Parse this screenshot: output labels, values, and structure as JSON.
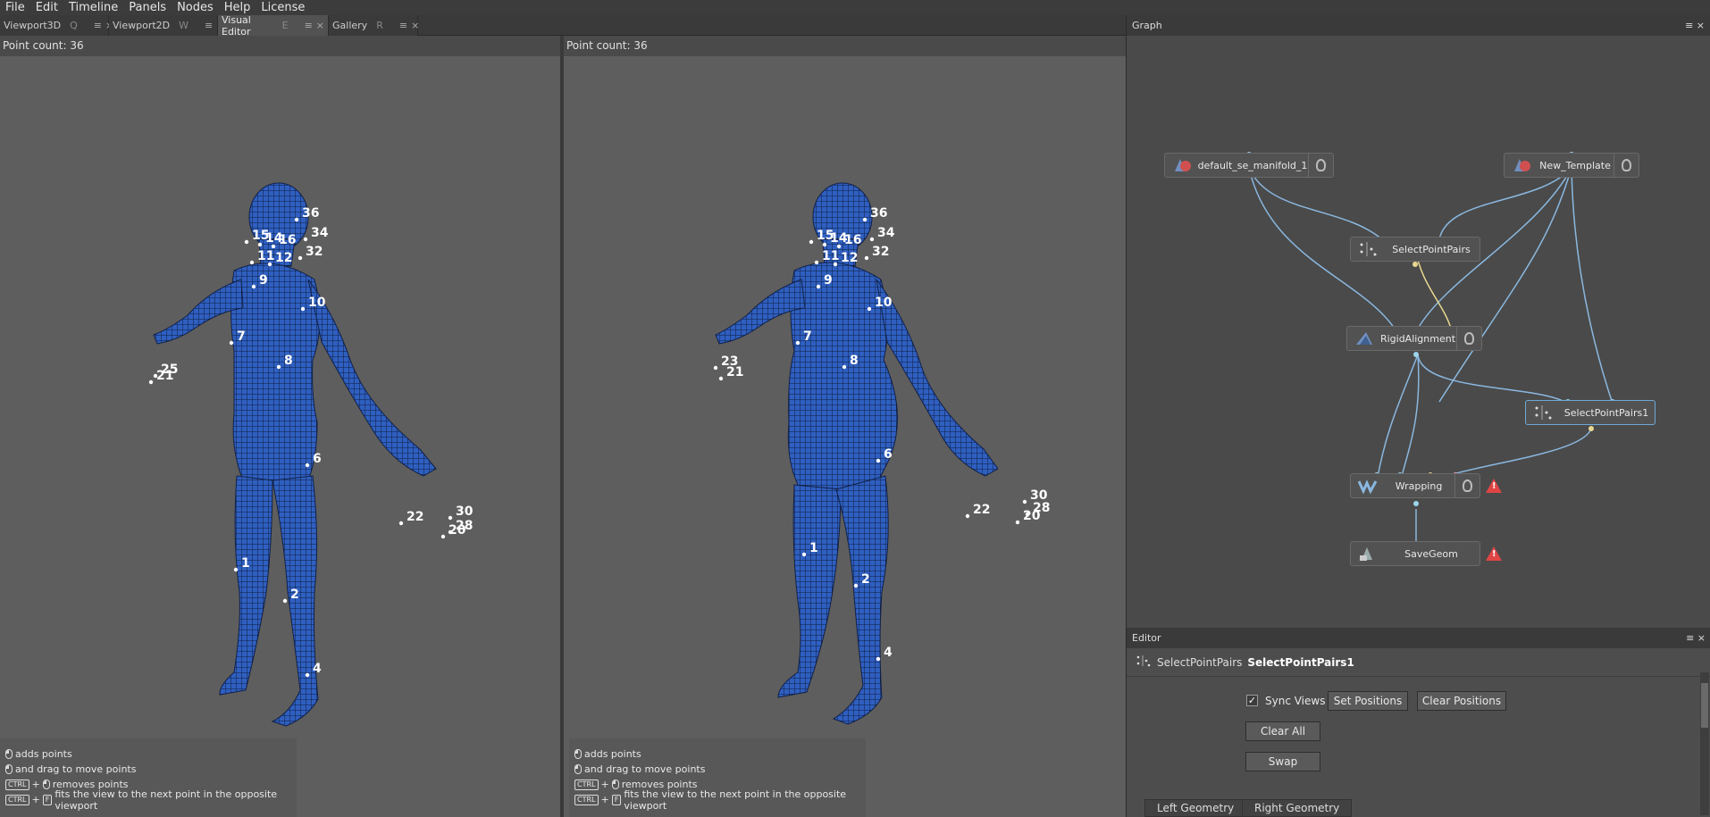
{
  "menu": [
    "File",
    "Edit",
    "Timeline",
    "Panels",
    "Nodes",
    "Help",
    "License"
  ],
  "tabs": [
    {
      "label": "Viewport3D",
      "key": "Q"
    },
    {
      "label": "Viewport2D",
      "key": "W"
    },
    {
      "label": "Visual Editor",
      "key": "E"
    },
    {
      "label": "Gallery",
      "key": "R"
    }
  ],
  "tab_menu_glyph": "≡",
  "tab_close_glyph": "×",
  "left_view": {
    "point_count": "Point count: 36",
    "landmarks": [
      "36",
      "15",
      "14",
      "16",
      "34",
      "32",
      "11",
      "12",
      "9",
      "10",
      "7",
      "25",
      "21",
      "8",
      "6",
      "22",
      "30",
      "28",
      "20",
      "1",
      "2",
      "4"
    ]
  },
  "right_view": {
    "point_count": "Point count: 36",
    "landmarks": [
      "36",
      "15",
      "14",
      "16",
      "34",
      "32",
      "11",
      "12",
      "9",
      "10",
      "7",
      "23",
      "21",
      "8",
      "6",
      "22",
      "30",
      "28",
      "20",
      "1",
      "2",
      "4"
    ]
  },
  "help": [
    {
      "keys": [
        "mouse-icon"
      ],
      "text": "adds points"
    },
    {
      "keys": [
        "mouse-icon"
      ],
      "text": "and drag to move points"
    },
    {
      "keys": [
        "CTRL",
        "+",
        "mouse-icon"
      ],
      "text": "removes points"
    },
    {
      "keys": [
        "CTRL",
        "+",
        "F"
      ],
      "text": "fits the view to the next point in the opposite viewport"
    }
  ],
  "graph": {
    "title": "Graph",
    "nodes": {
      "default_se": "default_se_manifold_1",
      "new_template": "New_Template",
      "select_point_pairs": "SelectPointPairs",
      "rigid_alignment": "RigidAlignment",
      "select_point_pairs1": "SelectPointPairs1",
      "wrapping": "Wrapping",
      "save_geom": "SaveGeom"
    },
    "warn_glyph": "!"
  },
  "editor": {
    "title": "Editor",
    "node_type": "SelectPointPairs",
    "node_name": "SelectPointPairs1",
    "sync_views": "Sync Views",
    "sync_checked": "✓",
    "set_positions": "Set Positions",
    "clear_positions": "Clear Positions",
    "clear_all": "Clear All",
    "swap": "Swap",
    "tab_left": "Left Geometry",
    "tab_right": "Right Geometry"
  },
  "colors": {
    "mesh": "#2f5fc0",
    "wire_blue": "#8ab8e0",
    "wire_yellow": "#e8d890",
    "warn": "#e04545"
  }
}
